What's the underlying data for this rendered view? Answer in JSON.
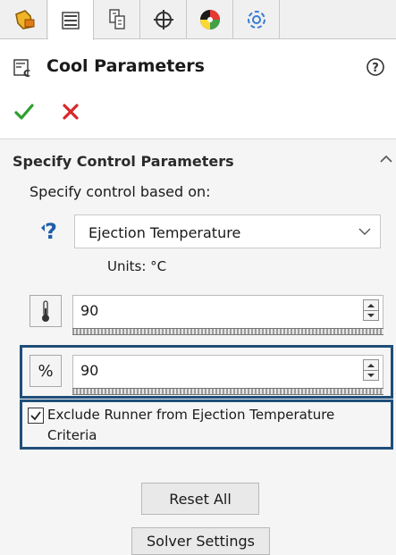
{
  "tabs": [
    {
      "icon": "feature-manager-icon"
    },
    {
      "icon": "property-manager-icon"
    },
    {
      "icon": "configuration-manager-icon"
    },
    {
      "icon": "dimxpert-icon"
    },
    {
      "icon": "display-manager-icon"
    },
    {
      "icon": "simulation-icon"
    }
  ],
  "panel": {
    "title": "Cool Parameters",
    "icon": "cool-parameters-icon"
  },
  "group": {
    "title": "Specify Control Parameters",
    "based_on_label": "Specify control based on:",
    "control_select": {
      "value": "Ejection Temperature"
    },
    "units": "Units: °C",
    "temperature_value": "90",
    "percent_label": "%",
    "percent_value": "90",
    "exclude_checkbox": {
      "label": "Exclude Runner from Ejection Temperature Criteria",
      "checked": true
    }
  },
  "buttons": {
    "reset_all": "Reset All",
    "solver_settings": "Solver Settings"
  },
  "colors": {
    "highlight_border": "#1f4e79",
    "ok_green": "#2e9e2e",
    "cancel_red": "#d9262a"
  }
}
